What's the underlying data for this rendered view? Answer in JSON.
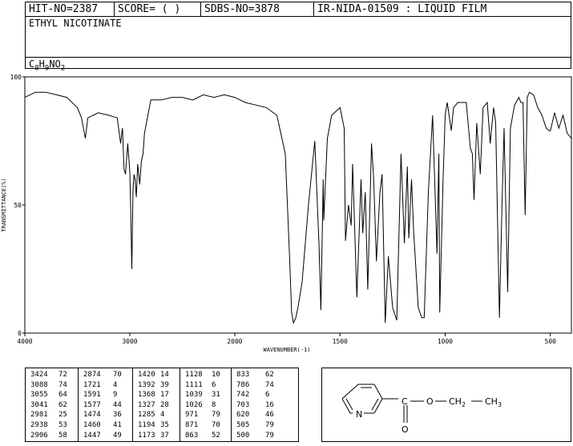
{
  "header": {
    "hit_no": "HIT-NO=2387",
    "score": "SCORE=  (   )",
    "sdbs_no": "SDBS-NO=3878",
    "method": "IR-NIDA-01509 : LIQUID FILM",
    "compound": "ETHYL NICOTINATE",
    "formula_parts": [
      "C",
      "8",
      "H",
      "9",
      "NO",
      "2"
    ]
  },
  "chart_data": {
    "type": "line",
    "xlabel": "WAVENUMBER(-1)",
    "ylabel": "TRANSMITTANCE(%)",
    "xlim": [
      4000,
      400
    ],
    "ylim": [
      0,
      100
    ],
    "x_ticks": [
      4000,
      3000,
      2000,
      1500,
      1000,
      500
    ],
    "y_ticks": [
      0,
      50,
      100
    ],
    "series": [
      {
        "x": [
          4000,
          3900,
          3800,
          3700,
          3600,
          3500,
          3460,
          3424,
          3400,
          3300,
          3200,
          3120,
          3088,
          3070,
          3055,
          3041,
          3020,
          3000,
          2990,
          2981,
          2970,
          2960,
          2950,
          2938,
          2925,
          2906,
          2890,
          2874,
          2860,
          2800,
          2700,
          2600,
          2500,
          2400,
          2300,
          2200,
          2100,
          2000,
          1950,
          1900,
          1850,
          1800,
          1760,
          1740,
          1730,
          1721,
          1710,
          1700,
          1680,
          1650,
          1620,
          1600,
          1591,
          1580,
          1577,
          1560,
          1540,
          1500,
          1480,
          1474,
          1460,
          1447,
          1440,
          1420,
          1400,
          1392,
          1380,
          1368,
          1350,
          1340,
          1327,
          1310,
          1300,
          1285,
          1270,
          1250,
          1230,
          1210,
          1194,
          1180,
          1173,
          1160,
          1150,
          1128,
          1120,
          1111,
          1100,
          1080,
          1060,
          1039,
          1030,
          1026,
          1010,
          1000,
          990,
          971,
          960,
          940,
          920,
          900,
          880,
          871,
          863,
          850,
          833,
          820,
          800,
          786,
          770,
          760,
          742,
          730,
          720,
          703,
          690,
          670,
          650,
          640,
          630,
          620,
          610,
          600,
          580,
          560,
          540,
          520,
          505,
          500,
          480,
          460,
          440,
          420,
          400
        ],
        "y": [
          92,
          94,
          94,
          93,
          92,
          88,
          84,
          76,
          84,
          86,
          85,
          84,
          74,
          80,
          64,
          62,
          74,
          63,
          45,
          25,
          55,
          62,
          60,
          53,
          66,
          58,
          67,
          70,
          78,
          91,
          91,
          92,
          92,
          91,
          93,
          92,
          93,
          92,
          90,
          89,
          88,
          85,
          70,
          30,
          8,
          4,
          6,
          10,
          20,
          50,
          75,
          35,
          9,
          60,
          44,
          76,
          85,
          88,
          80,
          36,
          50,
          42,
          66,
          14,
          60,
          39,
          55,
          17,
          74,
          60,
          28,
          55,
          62,
          4,
          30,
          10,
          5,
          70,
          35,
          65,
          37,
          60,
          40,
          10,
          8,
          6,
          6,
          55,
          85,
          31,
          70,
          8,
          60,
          85,
          90,
          79,
          88,
          90,
          90,
          90,
          72,
          70,
          52,
          82,
          62,
          88,
          90,
          74,
          88,
          82,
          6,
          50,
          80,
          16,
          80,
          89,
          92,
          90,
          90,
          46,
          92,
          94,
          93,
          88,
          85,
          80,
          79,
          79,
          86,
          80,
          85,
          78,
          76
        ]
      }
    ]
  },
  "peak_table": [
    [
      "3424",
      "72"
    ],
    [
      "3088",
      "74"
    ],
    [
      "3055",
      "64"
    ],
    [
      "3041",
      "62"
    ],
    [
      "2981",
      "25"
    ],
    [
      "2938",
      "53"
    ],
    [
      "2906",
      "58"
    ],
    [
      "2874",
      "70"
    ],
    [
      "1721",
      "4"
    ],
    [
      "1591",
      "9"
    ],
    [
      "1577",
      "44"
    ],
    [
      "1474",
      "36"
    ],
    [
      "1460",
      "41"
    ],
    [
      "1447",
      "49"
    ],
    [
      "1420",
      "14"
    ],
    [
      "1392",
      "39"
    ],
    [
      "1368",
      "17"
    ],
    [
      "1327",
      "28"
    ],
    [
      "1285",
      "4"
    ],
    [
      "1194",
      "35"
    ],
    [
      "1173",
      "37"
    ],
    [
      "1128",
      "10"
    ],
    [
      "1111",
      "6"
    ],
    [
      "1039",
      "31"
    ],
    [
      "1026",
      "8"
    ],
    [
      "971",
      "79"
    ],
    [
      "871",
      "70"
    ],
    [
      "863",
      "52"
    ],
    [
      "833",
      "62"
    ],
    [
      "786",
      "74"
    ],
    [
      "742",
      "6"
    ],
    [
      "703",
      "16"
    ],
    [
      "620",
      "46"
    ],
    [
      "505",
      "79"
    ],
    [
      "500",
      "79"
    ]
  ],
  "structure_labels": {
    "ring_n": "N",
    "carbonyl_c": "C",
    "carbonyl_o": "O",
    "ester_o": "O",
    "ch2": "CH",
    "ch2_sub": "2",
    "ch3": "CH",
    "ch3_sub": "3"
  }
}
